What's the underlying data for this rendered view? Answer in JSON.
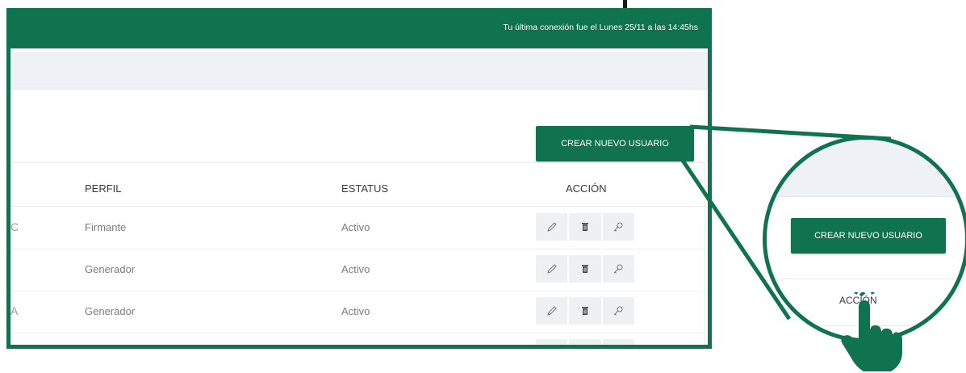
{
  "header": {
    "last_login": "Tu última conexión fue el Lunes 25/11 a las 14:45hs"
  },
  "toolbar": {
    "create_user": "CREAR NUEVO USUARIO"
  },
  "table": {
    "columns": [
      "PERFIL",
      "ESTATUS",
      "ACCIÓN"
    ],
    "rows": [
      {
        "cut": "C",
        "perfil": "Firmante",
        "estatus": "Activo"
      },
      {
        "cut": "",
        "perfil": "Generador",
        "estatus": "Activo"
      },
      {
        "cut": "A",
        "perfil": "Generador",
        "estatus": "Activo"
      }
    ]
  },
  "zoom": {
    "button": "CREAR NUEVO USUARIO",
    "column": "ACCIÓN"
  },
  "colors": {
    "brand": "#107350",
    "band": "#eef1f5"
  },
  "icons": [
    "pencil-icon",
    "trash-icon",
    "key-icon",
    "pointing-hand-icon"
  ]
}
